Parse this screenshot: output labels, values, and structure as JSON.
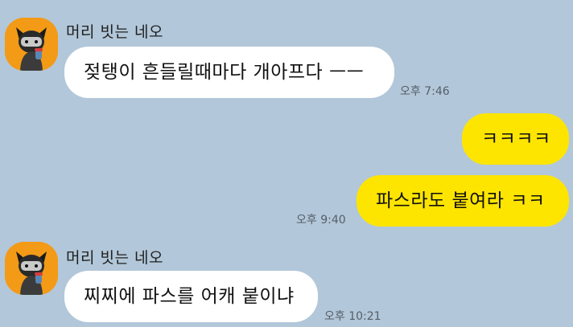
{
  "messages": [
    {
      "sender": "머리 빗는 네오",
      "text": "젖탱이 흔들릴때마다 개아프다 ㅡㅡ",
      "time": "오후 7:46",
      "direction": "incoming"
    },
    {
      "text": "ㅋㅋㅋㅋ",
      "direction": "outgoing"
    },
    {
      "text": "파스라도 붙여라 ㅋㅋ",
      "time": "오후 9:40",
      "direction": "outgoing"
    },
    {
      "sender": "머리 빗는 네오",
      "text": "찌찌에 파스를 어캐 붙이냐",
      "time": "오후 10:21",
      "direction": "incoming"
    }
  ],
  "colors": {
    "background": "#b2c7d9",
    "incoming_bubble": "#ffffff",
    "outgoing_bubble": "#fee500",
    "avatar_bg": "#f39a16"
  },
  "icons": {
    "avatar": "neo-character-avatar-icon"
  }
}
